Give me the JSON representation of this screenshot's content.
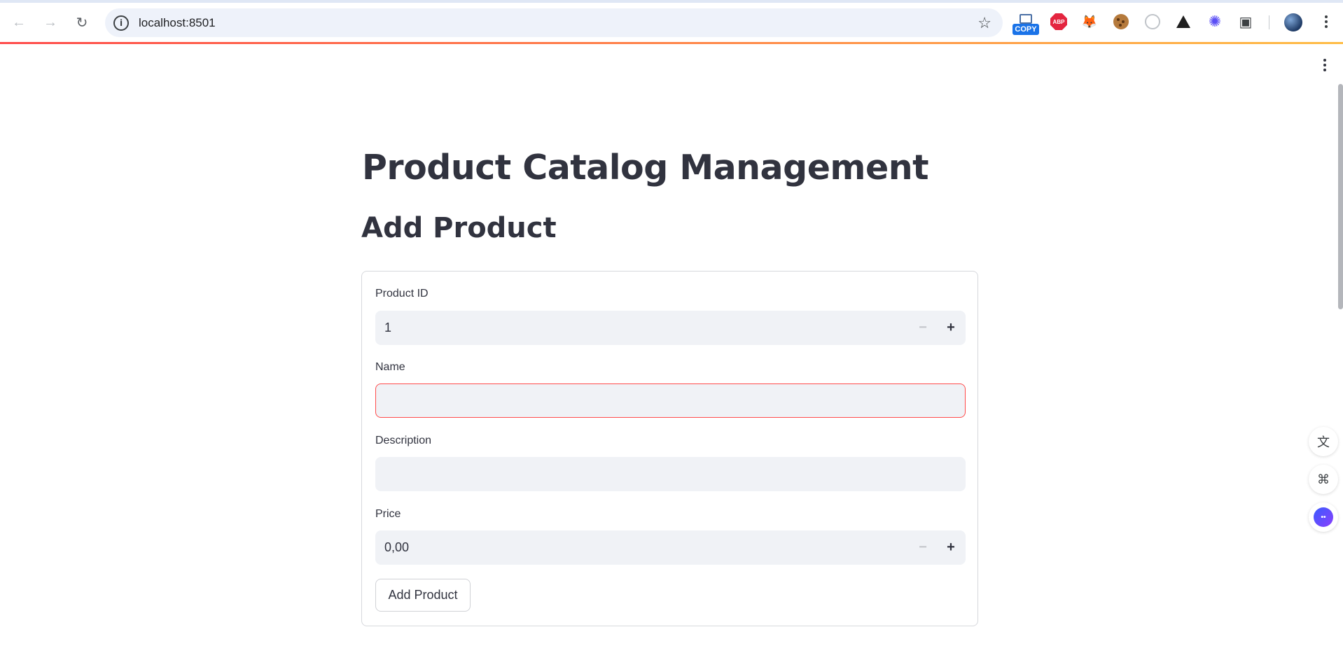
{
  "browser": {
    "url": "localhost:8501",
    "extensions": {
      "copy_badge": "COPY",
      "abp_label": "ABP"
    }
  },
  "app": {
    "title": "Product Catalog Management",
    "section_title": "Add Product"
  },
  "form": {
    "product_id": {
      "label": "Product ID",
      "value": "1"
    },
    "name": {
      "label": "Name",
      "value": ""
    },
    "description": {
      "label": "Description",
      "value": ""
    },
    "price": {
      "label": "Price",
      "value": "0,00"
    },
    "submit_label": "Add Product",
    "stepper_minus": "−",
    "stepper_plus": "+"
  },
  "colors": {
    "accent": "#ff4b4b",
    "text": "#31333f",
    "input_bg": "#f0f2f6"
  },
  "icons": {
    "back": "arrow-left-icon",
    "forward": "arrow-right-icon",
    "reload": "reload-icon",
    "site_info": "info-icon",
    "bookmark": "star-icon",
    "translate": "translate-icon",
    "apps": "apps-icon",
    "assistant": "assistant-bot-icon"
  }
}
